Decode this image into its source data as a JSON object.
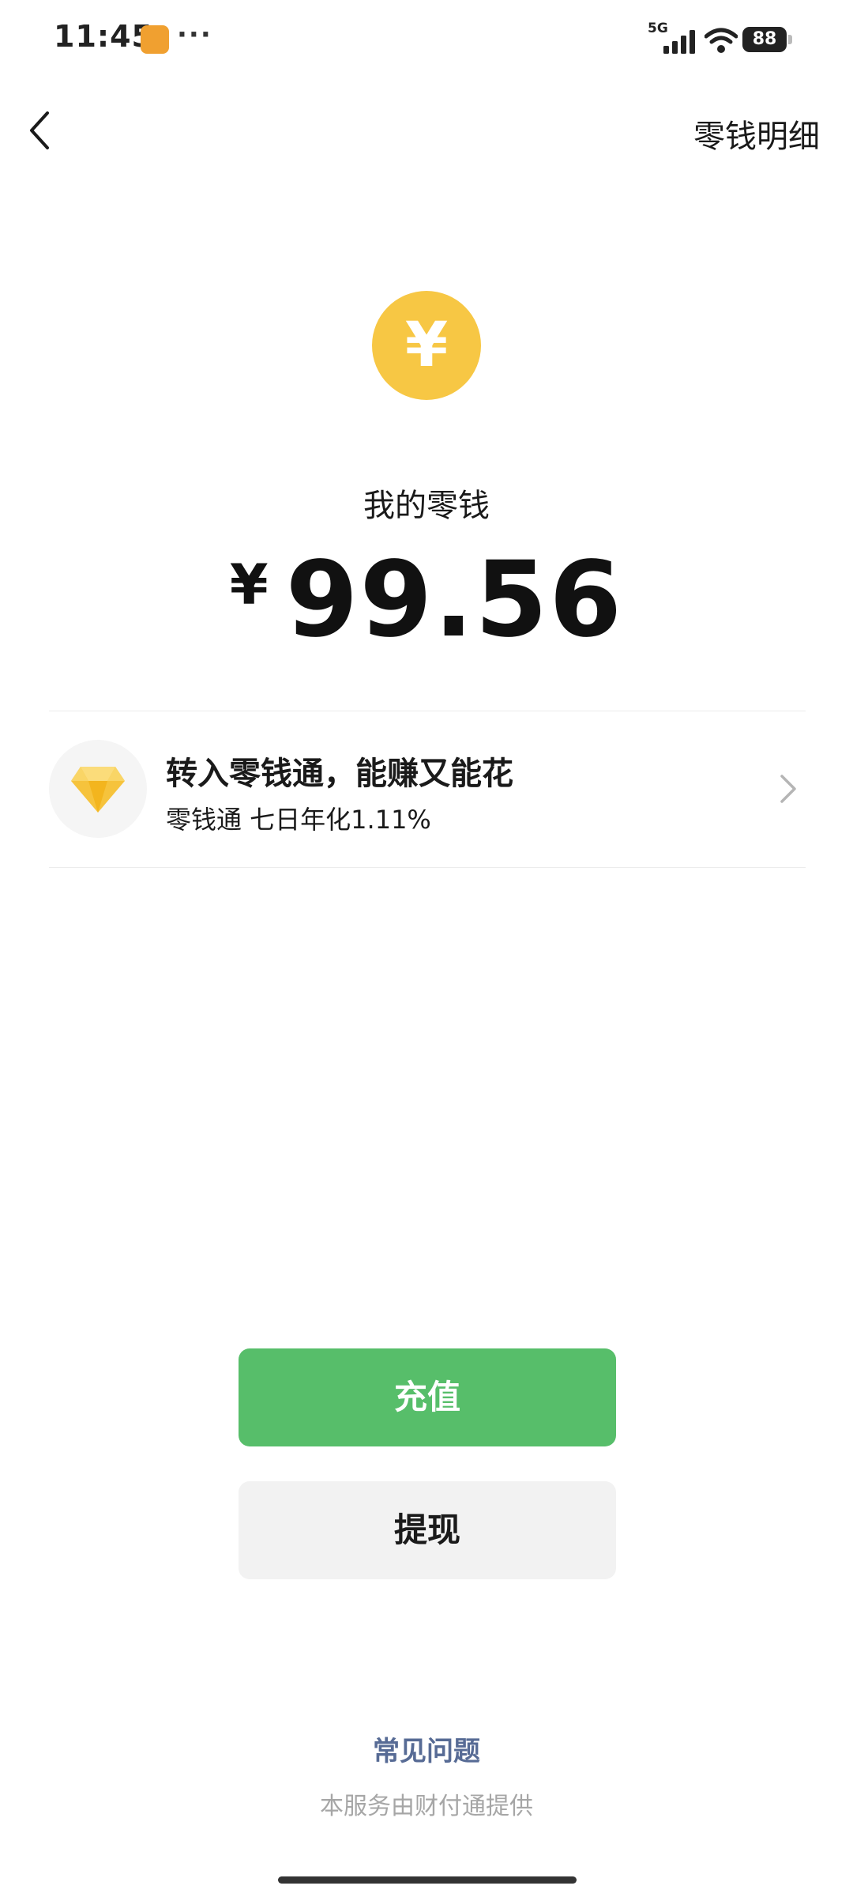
{
  "status_bar": {
    "time": "11:45",
    "more_icon": "ellipsis-icon",
    "network": "5G",
    "battery": "88"
  },
  "nav": {
    "back_icon": "chevron-left-icon",
    "details_link": "零钱明细"
  },
  "wallet": {
    "coin_symbol": "¥",
    "label": "我的零钱",
    "currency": "¥",
    "balance": "99.56"
  },
  "promo": {
    "icon": "diamond-icon",
    "title": "转入零钱通，能赚又能花",
    "subtitle": "零钱通 七日年化1.11%"
  },
  "actions": {
    "recharge_label": "充值",
    "withdraw_label": "提现"
  },
  "footer": {
    "faq_link": "常见问题",
    "provider_text": "本服务由财付通提供"
  },
  "colors": {
    "primary_green": "#57be6a",
    "coin_yellow": "#f7c744",
    "link_blue": "#576b95",
    "muted_gray": "#a6a6a6"
  }
}
